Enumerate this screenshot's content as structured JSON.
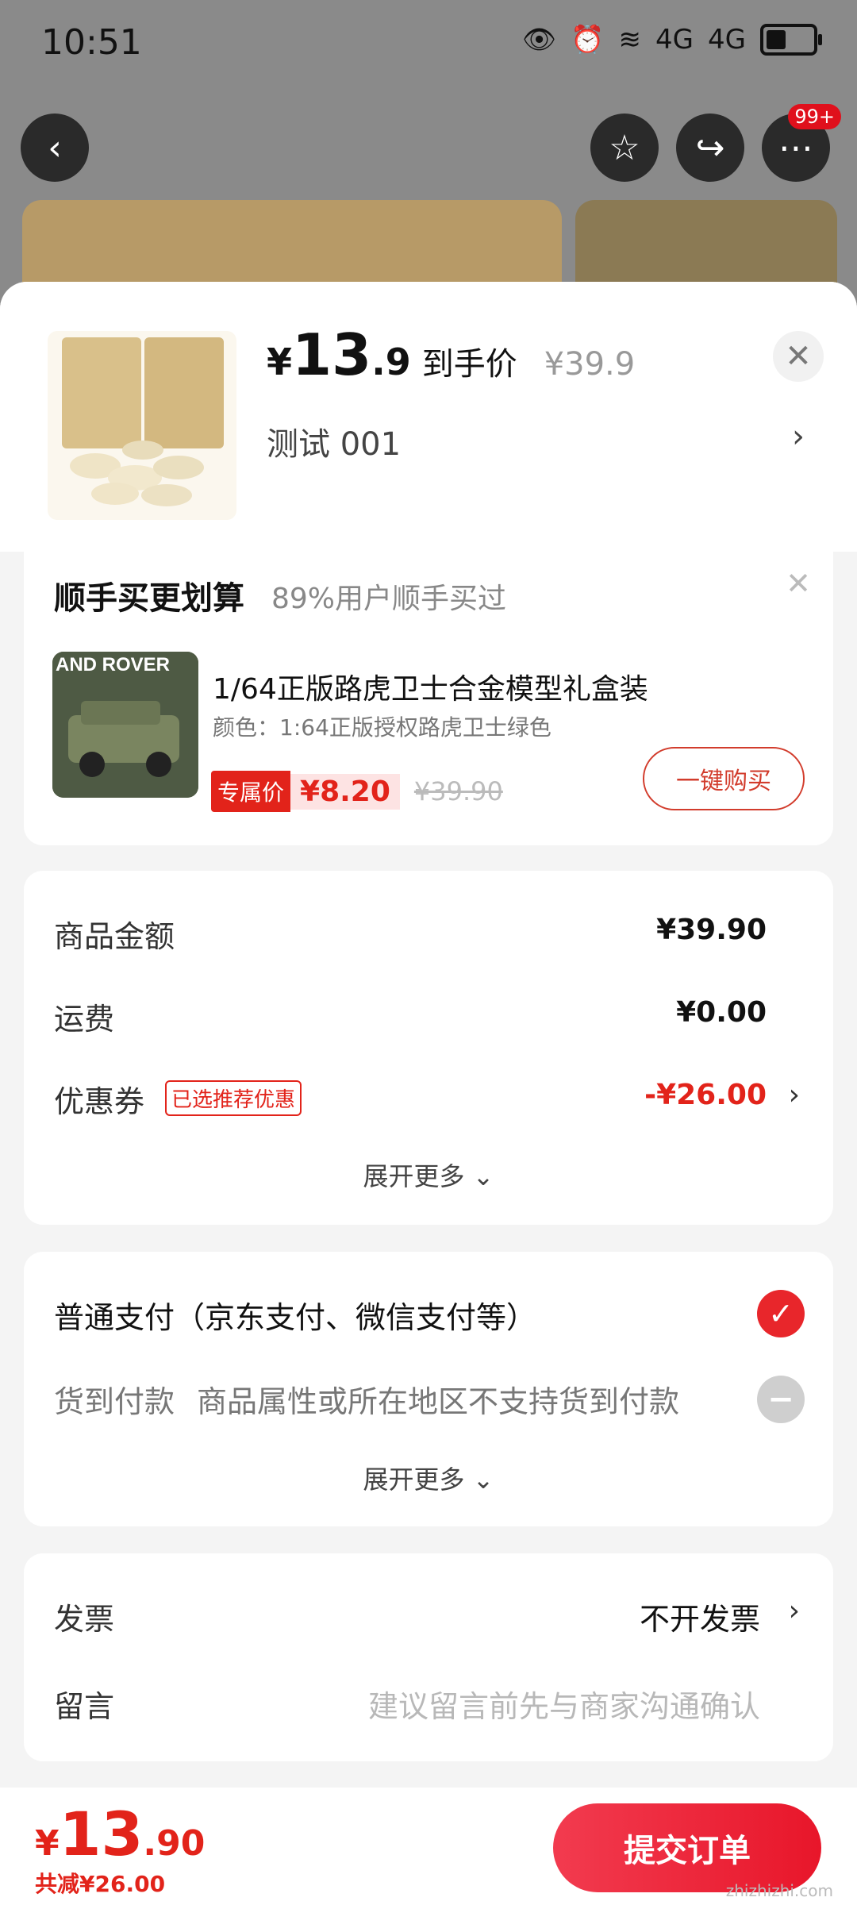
{
  "status_bar": {
    "time": "10:51",
    "network": "4G"
  },
  "top_nav": {
    "more_badge": "99+"
  },
  "product": {
    "price_symbol": "¥",
    "price_int": "13",
    "price_dec": ".9",
    "price_label": "到手价",
    "original_price": "¥39.9",
    "spec": "测试  001"
  },
  "upsell": {
    "title": "顺手买更划算",
    "subtitle": "89%用户顺手买过",
    "item_name": "1/64正版路虎卫士合金模型礼盒装",
    "item_color": "颜色：1:64正版授权路虎卫士绿色",
    "exclusive_tag": "专属价",
    "price": "¥8.20",
    "original_price": "¥39.90",
    "buy_button": "一键购买",
    "image_text": "AND ROVER"
  },
  "amounts": {
    "goods_label": "商品金额",
    "goods_value": "¥39.90",
    "shipping_label": "运费",
    "shipping_value": "¥0.00",
    "coupon_label": "优惠券",
    "coupon_tag": "已选推荐优惠",
    "coupon_value": "-¥26.00",
    "expand": "展开更多 ⌄"
  },
  "payment": {
    "normal_label": "普通支付（京东支付、微信支付等）",
    "cod_label": "货到付款",
    "cod_desc": "商品属性或所在地区不支持货到付款",
    "expand": "展开更多 ⌄"
  },
  "invoice": {
    "invoice_label": "发票",
    "invoice_value": "不开发票",
    "note_label": "留言",
    "note_placeholder": "建议留言前先与商家沟通确认"
  },
  "bottom_bar": {
    "total_symbol": "¥",
    "total_int": "13",
    "total_dec": ".90",
    "saved": "共减¥26.00",
    "submit": "提交订单"
  },
  "watermark": "zhizhizhi.com",
  "colors": {
    "accent_red": "#e2231a",
    "submit_gradient": [
      "#f23b4f",
      "#e8162a"
    ]
  },
  "icons": [
    "back-icon",
    "star-icon",
    "share-icon",
    "more-icon",
    "close-icon",
    "chevron-right-icon",
    "check-icon",
    "disabled-icon"
  ]
}
